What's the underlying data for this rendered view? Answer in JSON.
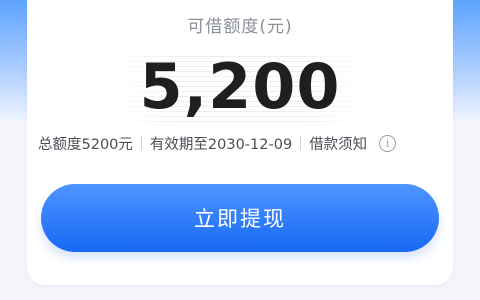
{
  "loan": {
    "title": "可借额度(元)",
    "amount": "5,200",
    "total_limit": "总额度5200元",
    "validity": "有效期至2030-12-09",
    "notice_link": "借款须知",
    "info_icon": "i",
    "withdraw_button": "立即提现"
  },
  "icons": {
    "info": "info-circle-icon"
  },
  "colors": {
    "accent": "#1768f5",
    "header_gradient_top": "#5ea3ff",
    "amount_text": "#1f1f1f",
    "muted_text": "#8a8f98"
  }
}
